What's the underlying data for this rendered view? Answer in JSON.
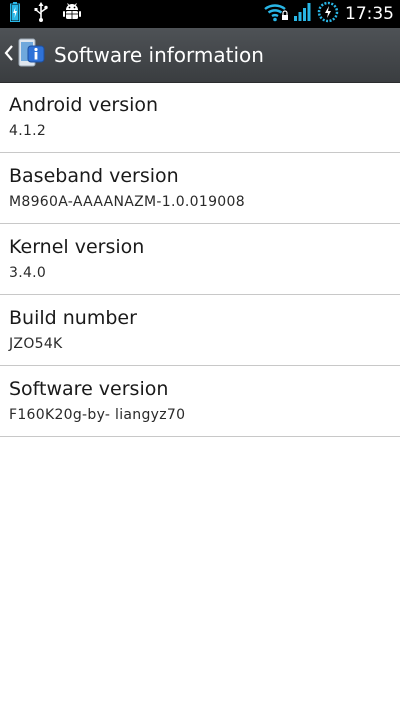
{
  "status_bar": {
    "time": "17:35",
    "icons": [
      "battery-charging-icon",
      "usb-icon",
      "android-debug-icon",
      "wifi-icon",
      "signal-icon",
      "charging-ring-icon"
    ]
  },
  "action_bar": {
    "title": "Software information",
    "icon": "software-info-icon"
  },
  "items": [
    {
      "label": "Android version",
      "value": "4.1.2"
    },
    {
      "label": "Baseband version",
      "value": "M8960A-AAAANAZM-1.0.019008"
    },
    {
      "label": "Kernel version",
      "value": "3.4.0"
    },
    {
      "label": "Build number",
      "value": "JZO54K"
    },
    {
      "label": "Software version",
      "value": "F160K20g-by- liangyz70"
    }
  ],
  "colors": {
    "accent": "#29b6e6",
    "action_bar": "#44484b",
    "divider": "#c8c8c8"
  }
}
